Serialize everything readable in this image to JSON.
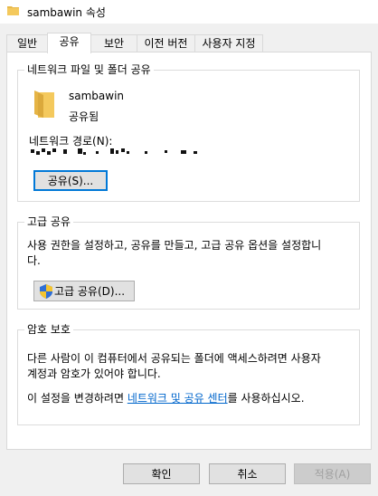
{
  "window": {
    "title": "sambawin 속성"
  },
  "tabs": [
    {
      "label": "일반",
      "active": false
    },
    {
      "label": "공유",
      "active": true
    },
    {
      "label": "보안",
      "active": false
    },
    {
      "label": "이전 버전",
      "active": false
    },
    {
      "label": "사용자 지정",
      "active": false
    }
  ],
  "network_sharing": {
    "group_title": "네트워크 파일 및 폴더 공유",
    "folder_name": "sambawin",
    "share_status": "공유됨",
    "network_path_label": "네트워크 경로(N):",
    "share_button": "공유(S)..."
  },
  "advanced_sharing": {
    "group_title": "고급 공유",
    "description_line1": "사용 권한을 설정하고, 공유를 만들고, 고급 공유 옵션을 설정합니",
    "description_line2": "다.",
    "button": "고급 공유(D)..."
  },
  "password_protection": {
    "group_title": "암호 보호",
    "description_line1": "다른 사람이 이 컴퓨터에서 공유되는 폴더에 액세스하려면 사용자",
    "description_line2": "계정과 암호가 있어야 합니다.",
    "change_prefix": "이 설정을 변경하려면 ",
    "link_text": "네트워크 및 공유 센터",
    "change_suffix": "를 사용하십시오."
  },
  "footer": {
    "ok": "확인",
    "cancel": "취소",
    "apply": "적용(A)"
  },
  "colors": {
    "folder_yellow": "#f4c95d",
    "link_blue": "#0066cc",
    "focus_blue": "#0078d7"
  }
}
